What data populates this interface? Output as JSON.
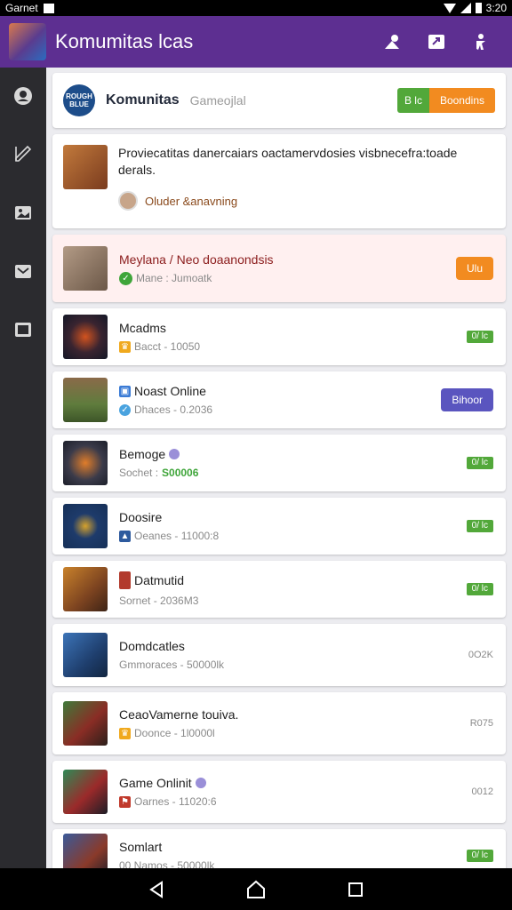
{
  "status_bar": {
    "carrier": "Garnet",
    "time": "3:20"
  },
  "app_bar": {
    "title": "Komumitas lcas"
  },
  "header": {
    "badge_text": "ROUGH BLUE",
    "name": "Komunitas",
    "subtitle": "Gameojlal",
    "btn_green": "B lc",
    "btn_orange": "Boondins"
  },
  "description": {
    "text": "Proviecatitas danercaiars oactamervdosies visbnecefra:toade derals.",
    "author": "Oluder &anavning"
  },
  "member": {
    "title": "Meylana / Neo doaanondsis",
    "status": "Mane : Jumoatk",
    "action": "Ulu"
  },
  "rows": [
    {
      "title": "Mcadms",
      "sub": "Bacct - 10050",
      "sub_highlight": "",
      "badge": "0/ lc",
      "badge_type": "green"
    },
    {
      "title": "Noast Online",
      "sub": "Dhaces - 0.2036",
      "sub_highlight": "",
      "badge": "Bihoor",
      "badge_type": "purple"
    },
    {
      "title": "Bemoge",
      "sub": "Sochet :",
      "sub_highlight": "S00006",
      "badge": "0/ lc",
      "badge_type": "green"
    },
    {
      "title": "Doosire",
      "sub": "Oeanes - 11000:8",
      "sub_highlight": "",
      "badge": "0/ lc",
      "badge_type": "green"
    },
    {
      "title": "Datmutid",
      "sub": "Sornet - 2036M3",
      "sub_highlight": "",
      "badge": "0/ lc",
      "badge_type": "green"
    },
    {
      "title": "Domdcatles",
      "sub": "Gmmoraces - 50000lk",
      "sub_highlight": "",
      "badge": "0O2K",
      "badge_type": "text"
    },
    {
      "title": "CeaoVamerne touiva.",
      "sub": "Doonce - 1l0000l",
      "sub_highlight": "",
      "badge": "R075",
      "badge_type": "text"
    },
    {
      "title": "Game Onlinit",
      "sub": "Oarnes - 11020:6",
      "sub_highlight": "",
      "badge": "0012",
      "badge_type": "text"
    },
    {
      "title": "Somlart",
      "sub": "00 Namos - 50000lk",
      "sub_highlight": "",
      "badge": "0/ lc",
      "badge_type": "green"
    }
  ],
  "colors": {
    "app_bar": "#5d2f91",
    "accent_green": "#52a83a",
    "accent_orange": "#f28b20",
    "accent_purple": "#5a55bf"
  }
}
